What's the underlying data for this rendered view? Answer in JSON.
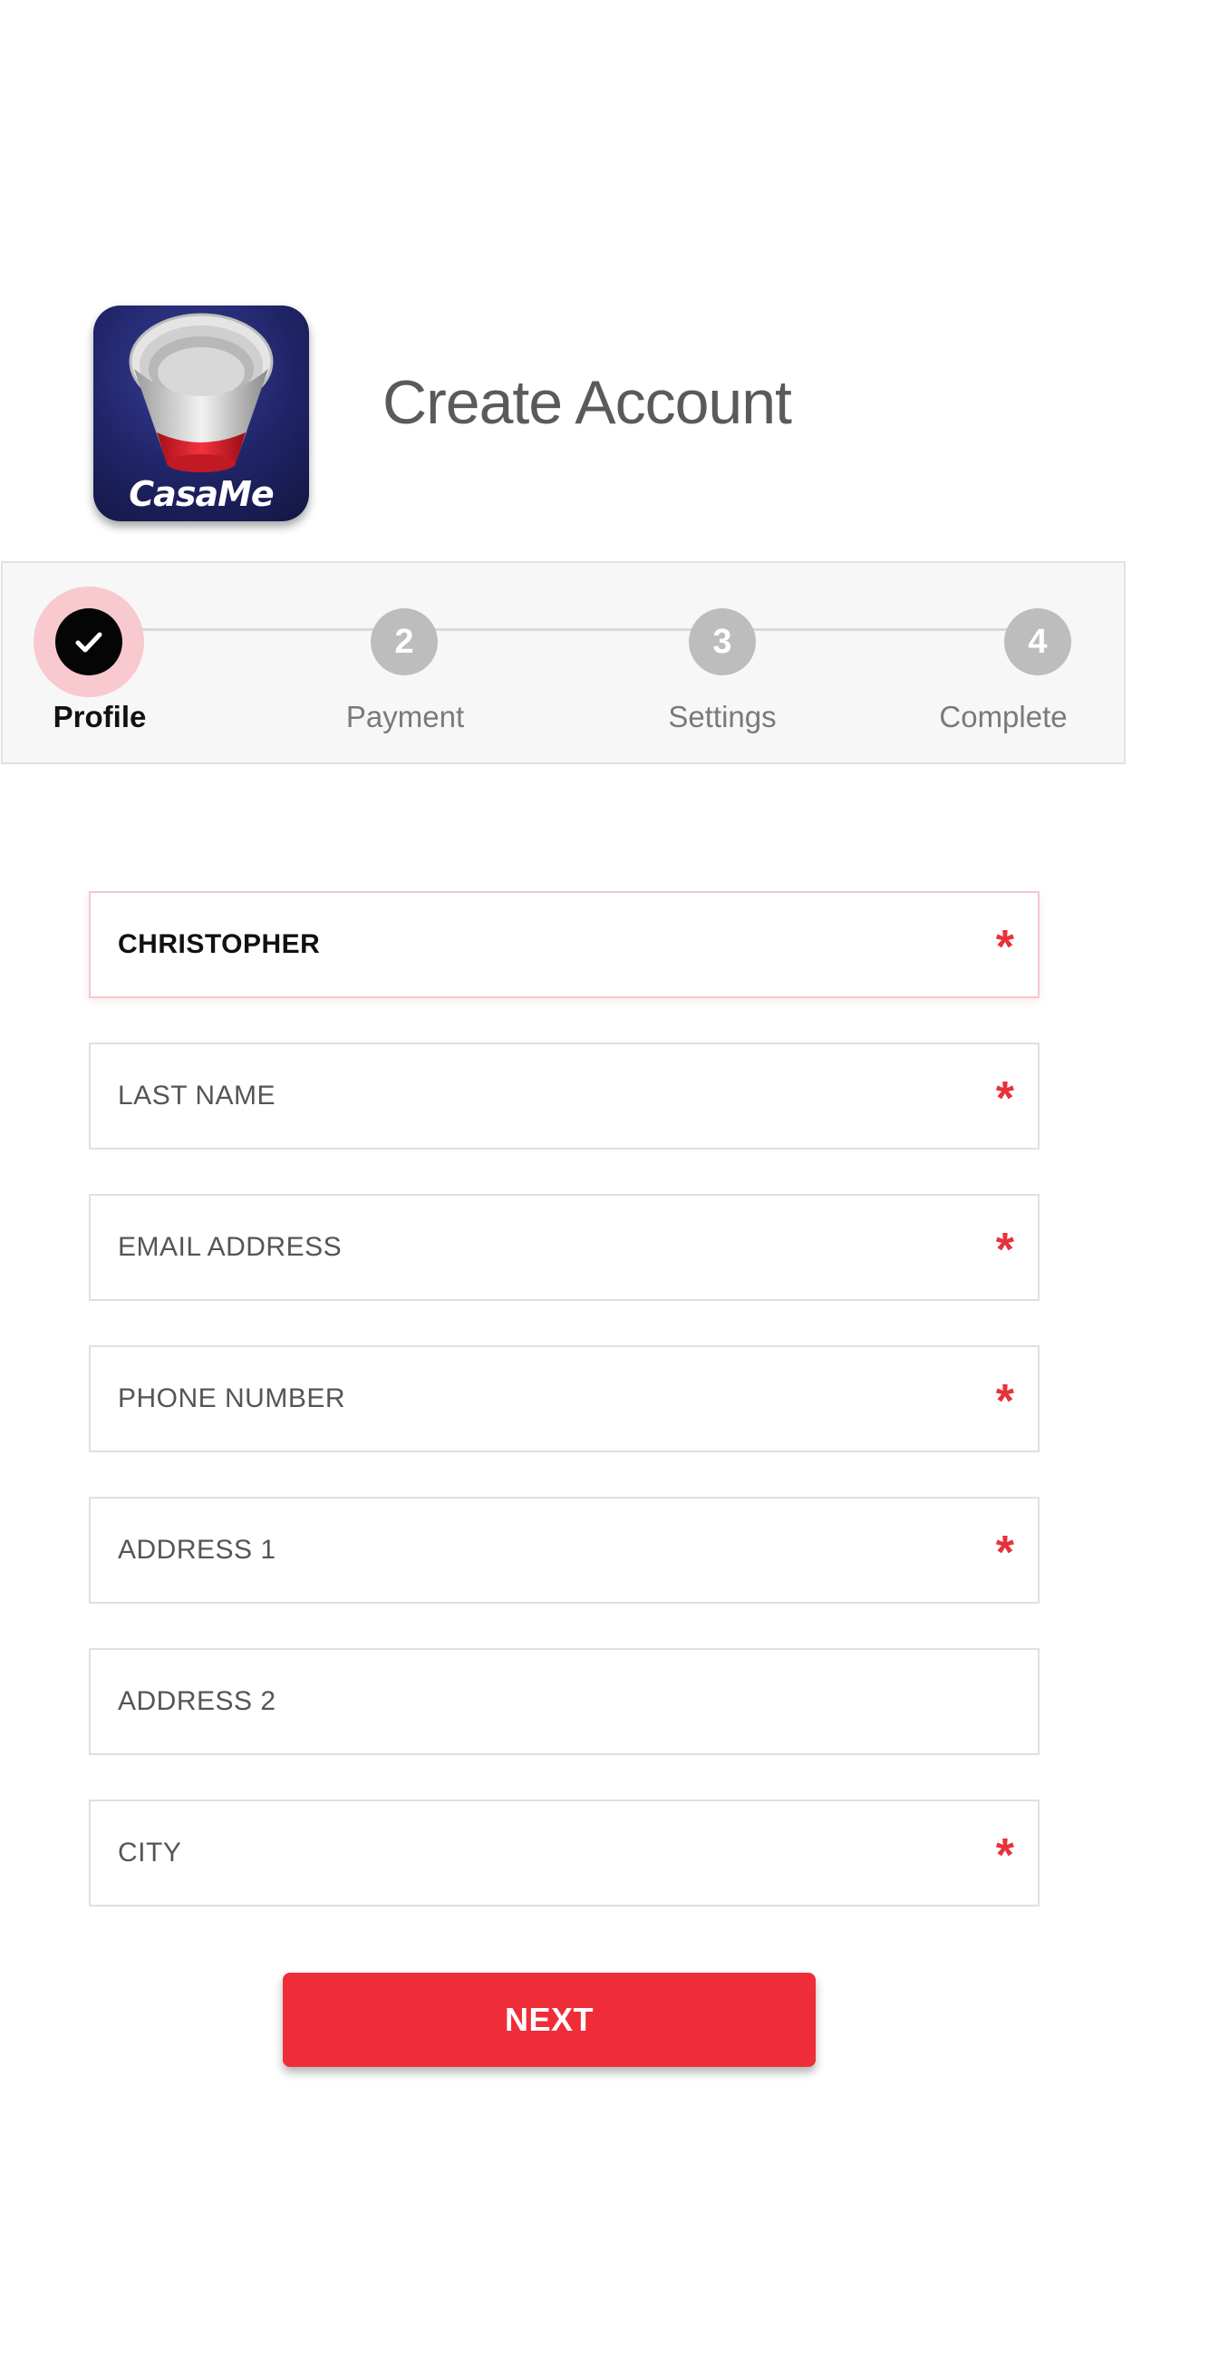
{
  "app": {
    "icon_label": "CasaMe",
    "icon": "red-cup-stack-icon"
  },
  "header": {
    "title": "Create Account"
  },
  "stepper": {
    "steps": [
      {
        "label": "Profile",
        "badge": "",
        "state": "completed-current"
      },
      {
        "label": "Payment",
        "badge": "2",
        "state": "pending"
      },
      {
        "label": "Settings",
        "badge": "3",
        "state": "pending"
      },
      {
        "label": "Complete",
        "badge": "4",
        "state": "pending"
      }
    ]
  },
  "form": {
    "first_name": {
      "value": "CHRISTOPHER",
      "required": true
    },
    "last_name": {
      "placeholder": "LAST NAME",
      "required": true
    },
    "email": {
      "placeholder": "EMAIL ADDRESS",
      "required": true
    },
    "phone": {
      "placeholder": "PHONE NUMBER",
      "required": true
    },
    "address1": {
      "placeholder": "ADDRESS 1",
      "required": true
    },
    "address2": {
      "placeholder": "ADDRESS 2",
      "required": false
    },
    "city": {
      "placeholder": "CITY",
      "required": true
    },
    "required_mark": "*"
  },
  "actions": {
    "next_label": "NEXT"
  },
  "colors": {
    "accent": "#ef2d38",
    "active_step": "#050505",
    "inactive_step": "#bdbdbd",
    "halo": "#f8c9cf"
  }
}
